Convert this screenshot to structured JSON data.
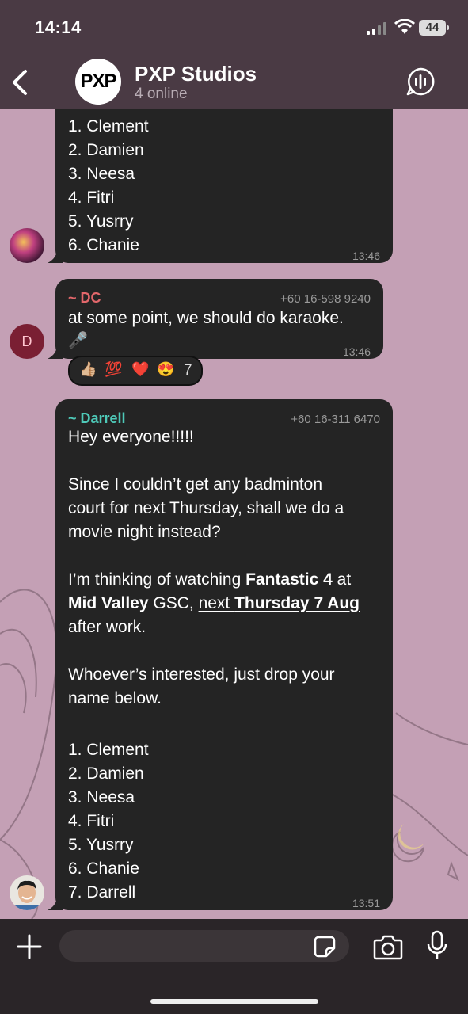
{
  "status_bar": {
    "time": "14:14",
    "battery": "44"
  },
  "header": {
    "group_avatar_text": "PXP",
    "title": "PXP Studios",
    "subtitle": "4 online"
  },
  "messages": [
    {
      "lines": [
        "1. Clement",
        "2. Damien",
        "3. Neesa",
        "4. Fitri",
        "5. Yusrry",
        "6. Chanie"
      ],
      "time": "13:46"
    },
    {
      "sender": "~ DC",
      "phone": "+60 16-598 9240",
      "text": "at some point, we should do karaoke.",
      "text2": "🎤",
      "time": "13:46",
      "avatar_initial": "D",
      "reactions": {
        "emojis": [
          "👍🏼",
          "💯",
          "❤️",
          "😍"
        ],
        "count": "7"
      }
    },
    {
      "sender": "~ Darrell",
      "phone": "+60 16-311 6470",
      "greeting": "Hey everyone!!!!!",
      "para1": [
        "Since I couldn’t get any badminton",
        "court for next Thursday, shall we do a",
        "movie night instead?"
      ],
      "para2_line1_a": "I’m thinking of watching ",
      "para2_line1_b": "Fantastic 4",
      "para2_line1_c": " at",
      "para2_line2_a": "Mid Valley",
      "para2_line2_b": " GSC, ",
      "para2_line2_c": "next ",
      "para2_line2_d": "Thursday 7 Aug",
      "para2_line3": "after work.",
      "para3": [
        "Whoever’s interested, just drop your",
        "name below."
      ],
      "list": [
        "1. Clement",
        "2. Damien",
        "3. Neesa",
        "4. Fitri",
        "5. Yusrry",
        "6. Chanie",
        "7. Darrell"
      ],
      "time": "13:51"
    }
  ],
  "composer": {
    "placeholder": ""
  },
  "colors": {
    "dc_name": "#e2676b",
    "darrell_name": "#4ec9b8",
    "bubble": "#242424",
    "header": "#4a3a44"
  },
  "icons": [
    "back-icon",
    "voice-chat-icon",
    "plus-icon",
    "sticker-icon",
    "camera-icon",
    "microphone-icon"
  ]
}
